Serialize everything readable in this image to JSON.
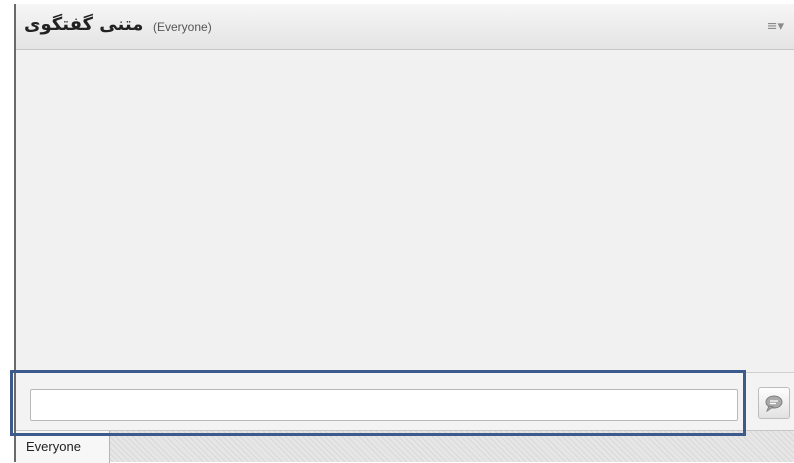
{
  "header": {
    "title": "متنی گفتگوی",
    "audience": "(Everyone)",
    "menu_label": "≡▾"
  },
  "composer": {
    "input_value": "",
    "input_placeholder": "",
    "send_icon": "speech-bubble-icon"
  },
  "tabs": [
    {
      "label": "Everyone",
      "selected": true
    }
  ],
  "colors": {
    "highlight_border": "#3c5a8c",
    "panel_background": "#f1f1f1"
  }
}
